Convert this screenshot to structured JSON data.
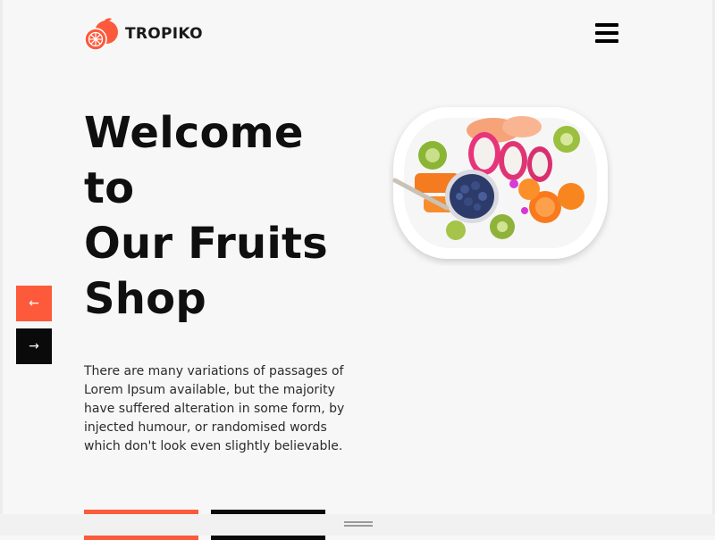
{
  "header": {
    "brand": "TROPIKO",
    "logo_icon": "orange-fruit-icon",
    "menu_icon": "hamburger-menu-icon"
  },
  "hero": {
    "title_lines": [
      "Welcome",
      "to",
      "Our Fruits",
      "Shop"
    ],
    "description": "There are many variations of passages of Lorem Ipsum available, but the majority have suffered alteration in some form, by injected humour, or randomised words which don't look even slightly believable.",
    "image_icon": "fruit-platter-image"
  },
  "slider": {
    "prev_icon": "arrow-left-icon",
    "next_icon": "arrow-right-icon",
    "prev_symbol": "←",
    "next_symbol": "→"
  },
  "colors": {
    "accent": "#fc5a3a",
    "dark": "#0a0a0a",
    "background": "#f8f7f8"
  }
}
